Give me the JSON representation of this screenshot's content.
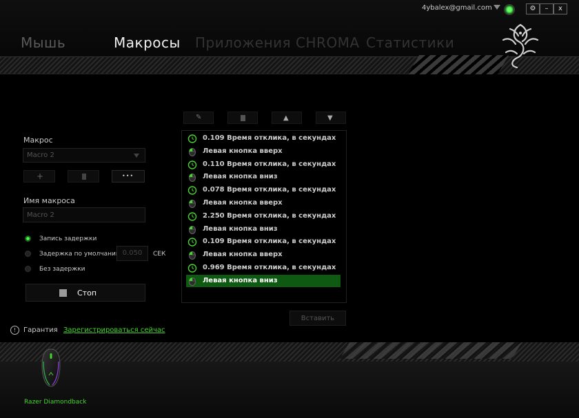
{
  "header": {
    "account": "4ybalex@gmail.com",
    "tabs": [
      {
        "label": "Мышь"
      },
      {
        "label": "Макросы"
      },
      {
        "label": "Приложения CHROMA"
      },
      {
        "label": "Статистики"
      }
    ],
    "window_buttons": {
      "settings": "⚙",
      "minimize": "–",
      "close": "x"
    }
  },
  "toolbar": {
    "edit": "✎",
    "delete": "🗑",
    "up": "▲",
    "down": "▼"
  },
  "macro": {
    "section_label": "Макрос",
    "selected": "Macro 2",
    "add": "+",
    "delete": "🗑",
    "more": "•••",
    "name_label": "Имя макроса",
    "name_value": "Macro 2",
    "delay_options": [
      {
        "label": "Запись задержки",
        "selected": true
      },
      {
        "label": "Задержка по умолчанию",
        "selected": false
      },
      {
        "label": "Без задержки",
        "selected": false
      }
    ],
    "default_delay_value": "0.050",
    "delay_unit": "СЕК",
    "stop_label": "Стоп"
  },
  "events": [
    {
      "type": "delay",
      "text": "0.109 Время отклика, в секундах"
    },
    {
      "type": "mouse",
      "text": "Левая кнопка вверх"
    },
    {
      "type": "delay",
      "text": "0.110 Время отклика, в секундах"
    },
    {
      "type": "mouse",
      "text": "Левая кнопка вниз"
    },
    {
      "type": "delay",
      "text": "0.078 Время отклика, в секундах"
    },
    {
      "type": "mouse",
      "text": "Левая кнопка вверх"
    },
    {
      "type": "delay",
      "text": "2.250 Время отклика, в секундах"
    },
    {
      "type": "mouse",
      "text": "Левая кнопка вниз"
    },
    {
      "type": "delay",
      "text": "0.109 Время отклика, в секундах"
    },
    {
      "type": "mouse",
      "text": "Левая кнопка вверх"
    },
    {
      "type": "delay",
      "text": "0.969 Время отклика, в секундах"
    },
    {
      "type": "mouse",
      "text": "Левая кнопка вниз",
      "selected": true
    }
  ],
  "insert_label": "Вставить",
  "warranty": {
    "label": "Гарантия",
    "link": "Зарегистрироваться сейчас"
  },
  "device": {
    "name": "Razer Diamondback"
  },
  "colors": {
    "accent": "#44d62c",
    "selected_row": "#0f5a12"
  }
}
